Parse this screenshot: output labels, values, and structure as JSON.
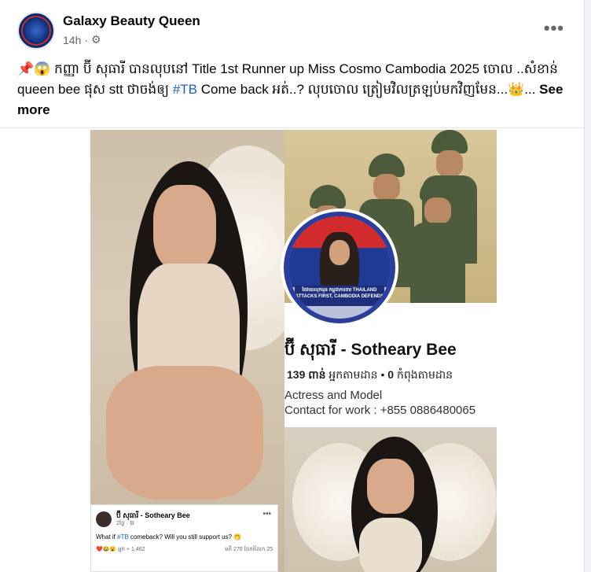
{
  "post": {
    "page_name": "Galaxy Beauty Queen",
    "time": "14h",
    "audience_icon": "gear-icon",
    "text_prefix": "📌😱 កញ្ញា ប៊ី សុធារី បានលុបនៅ Title 1st Runner up Miss Cosmo Cambodia 2025 ចោល ..សំខាន់ queen bee ផុស stt ថាចង់ឲ្យ ",
    "hashtag": "#TB",
    "text_suffix": " Come back អត់..? លុបចោល ត្រៀមវិលត្រឡប់មកវិញមែន...👑... ",
    "see_more": "See more"
  },
  "profile": {
    "name": "ប៊ី សុធារី - Sotheary Bee",
    "followers": "139 ពាន់",
    "followers_label": "អ្នកតាមដាន",
    "following": "0",
    "following_label": "កំពុងតាមដាន",
    "bio_line1": "Actress and Model",
    "bio_line2": "Contact for work : +855 0886480065",
    "badge_text": "ថៃវាយលុកមុន កម្ពុជាការពារ THAILAND ATTACKS FIRST, CAMBODIA DEFENDS"
  },
  "inset": {
    "name": "ប៊ី សុធារី - Sotheary Bee",
    "time": "2ថ្ងៃ · ⚙",
    "text_before": "What if ",
    "hashtag": "#TB",
    "text_after": " comeback? Will you still support us? 🤭",
    "reactions": "❤️😂😮 អ្នក + 1,462",
    "stats": "មតិ 270   ចែករំលែក 25"
  }
}
